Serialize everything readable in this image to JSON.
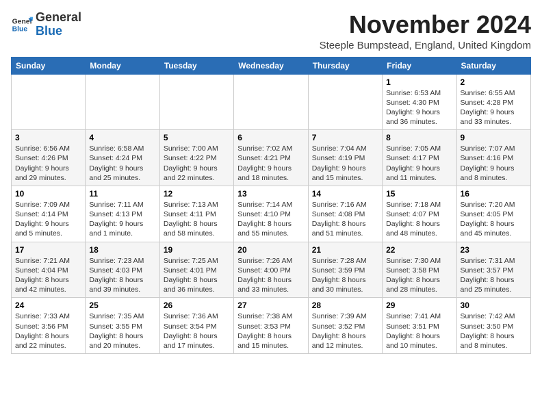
{
  "logo": {
    "general": "General",
    "blue": "Blue"
  },
  "title": "November 2024",
  "location": "Steeple Bumpstead, England, United Kingdom",
  "days_of_week": [
    "Sunday",
    "Monday",
    "Tuesday",
    "Wednesday",
    "Thursday",
    "Friday",
    "Saturday"
  ],
  "weeks": [
    [
      {
        "day": "",
        "info": ""
      },
      {
        "day": "",
        "info": ""
      },
      {
        "day": "",
        "info": ""
      },
      {
        "day": "",
        "info": ""
      },
      {
        "day": "",
        "info": ""
      },
      {
        "day": "1",
        "info": "Sunrise: 6:53 AM\nSunset: 4:30 PM\nDaylight: 9 hours and 36 minutes."
      },
      {
        "day": "2",
        "info": "Sunrise: 6:55 AM\nSunset: 4:28 PM\nDaylight: 9 hours and 33 minutes."
      }
    ],
    [
      {
        "day": "3",
        "info": "Sunrise: 6:56 AM\nSunset: 4:26 PM\nDaylight: 9 hours and 29 minutes."
      },
      {
        "day": "4",
        "info": "Sunrise: 6:58 AM\nSunset: 4:24 PM\nDaylight: 9 hours and 25 minutes."
      },
      {
        "day": "5",
        "info": "Sunrise: 7:00 AM\nSunset: 4:22 PM\nDaylight: 9 hours and 22 minutes."
      },
      {
        "day": "6",
        "info": "Sunrise: 7:02 AM\nSunset: 4:21 PM\nDaylight: 9 hours and 18 minutes."
      },
      {
        "day": "7",
        "info": "Sunrise: 7:04 AM\nSunset: 4:19 PM\nDaylight: 9 hours and 15 minutes."
      },
      {
        "day": "8",
        "info": "Sunrise: 7:05 AM\nSunset: 4:17 PM\nDaylight: 9 hours and 11 minutes."
      },
      {
        "day": "9",
        "info": "Sunrise: 7:07 AM\nSunset: 4:16 PM\nDaylight: 9 hours and 8 minutes."
      }
    ],
    [
      {
        "day": "10",
        "info": "Sunrise: 7:09 AM\nSunset: 4:14 PM\nDaylight: 9 hours and 5 minutes."
      },
      {
        "day": "11",
        "info": "Sunrise: 7:11 AM\nSunset: 4:13 PM\nDaylight: 9 hours and 1 minute."
      },
      {
        "day": "12",
        "info": "Sunrise: 7:13 AM\nSunset: 4:11 PM\nDaylight: 8 hours and 58 minutes."
      },
      {
        "day": "13",
        "info": "Sunrise: 7:14 AM\nSunset: 4:10 PM\nDaylight: 8 hours and 55 minutes."
      },
      {
        "day": "14",
        "info": "Sunrise: 7:16 AM\nSunset: 4:08 PM\nDaylight: 8 hours and 51 minutes."
      },
      {
        "day": "15",
        "info": "Sunrise: 7:18 AM\nSunset: 4:07 PM\nDaylight: 8 hours and 48 minutes."
      },
      {
        "day": "16",
        "info": "Sunrise: 7:20 AM\nSunset: 4:05 PM\nDaylight: 8 hours and 45 minutes."
      }
    ],
    [
      {
        "day": "17",
        "info": "Sunrise: 7:21 AM\nSunset: 4:04 PM\nDaylight: 8 hours and 42 minutes."
      },
      {
        "day": "18",
        "info": "Sunrise: 7:23 AM\nSunset: 4:03 PM\nDaylight: 8 hours and 39 minutes."
      },
      {
        "day": "19",
        "info": "Sunrise: 7:25 AM\nSunset: 4:01 PM\nDaylight: 8 hours and 36 minutes."
      },
      {
        "day": "20",
        "info": "Sunrise: 7:26 AM\nSunset: 4:00 PM\nDaylight: 8 hours and 33 minutes."
      },
      {
        "day": "21",
        "info": "Sunrise: 7:28 AM\nSunset: 3:59 PM\nDaylight: 8 hours and 30 minutes."
      },
      {
        "day": "22",
        "info": "Sunrise: 7:30 AM\nSunset: 3:58 PM\nDaylight: 8 hours and 28 minutes."
      },
      {
        "day": "23",
        "info": "Sunrise: 7:31 AM\nSunset: 3:57 PM\nDaylight: 8 hours and 25 minutes."
      }
    ],
    [
      {
        "day": "24",
        "info": "Sunrise: 7:33 AM\nSunset: 3:56 PM\nDaylight: 8 hours and 22 minutes."
      },
      {
        "day": "25",
        "info": "Sunrise: 7:35 AM\nSunset: 3:55 PM\nDaylight: 8 hours and 20 minutes."
      },
      {
        "day": "26",
        "info": "Sunrise: 7:36 AM\nSunset: 3:54 PM\nDaylight: 8 hours and 17 minutes."
      },
      {
        "day": "27",
        "info": "Sunrise: 7:38 AM\nSunset: 3:53 PM\nDaylight: 8 hours and 15 minutes."
      },
      {
        "day": "28",
        "info": "Sunrise: 7:39 AM\nSunset: 3:52 PM\nDaylight: 8 hours and 12 minutes."
      },
      {
        "day": "29",
        "info": "Sunrise: 7:41 AM\nSunset: 3:51 PM\nDaylight: 8 hours and 10 minutes."
      },
      {
        "day": "30",
        "info": "Sunrise: 7:42 AM\nSunset: 3:50 PM\nDaylight: 8 hours and 8 minutes."
      }
    ]
  ]
}
